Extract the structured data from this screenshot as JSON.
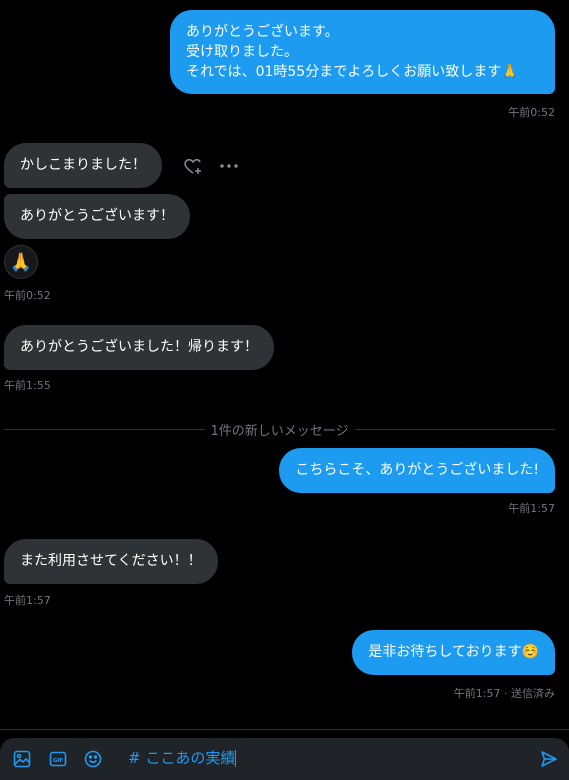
{
  "messages": {
    "m1": {
      "lines": [
        "ありがとうございます。",
        "受け取りました。",
        "それでは、01時55分までよろしくお願い致します🙏"
      ],
      "time": "午前0:52"
    },
    "m2": {
      "text": "かしこまりました！"
    },
    "m3": {
      "text": "ありがとうございます！"
    },
    "m3_reaction": "🙏",
    "m3_time": "午前0:52",
    "m4": {
      "text": "ありがとうございました！帰ります！",
      "time": "午前1:55"
    },
    "m5": {
      "text": "こちらこそ、ありがとうございました!",
      "time": "午前1:57"
    },
    "m6": {
      "text": "また利用させてください！！",
      "time": "午前1:57"
    },
    "m7": {
      "text": "是非お待ちしております☺️",
      "time": "午前1:57 · 送信済み"
    }
  },
  "divider": {
    "label": "1件の新しいメッセージ"
  },
  "composer": {
    "value": "# ここあの実績"
  },
  "colors": {
    "accent": "#1d9bf0",
    "received_bubble": "#2f3336",
    "background": "#000000",
    "muted_text": "#71767b"
  },
  "icons": {
    "react": "heart-plus-icon",
    "more": "more-horizontal-icon",
    "image": "image-icon",
    "gif": "gif-icon",
    "emoji": "emoji-icon",
    "send": "send-icon"
  }
}
